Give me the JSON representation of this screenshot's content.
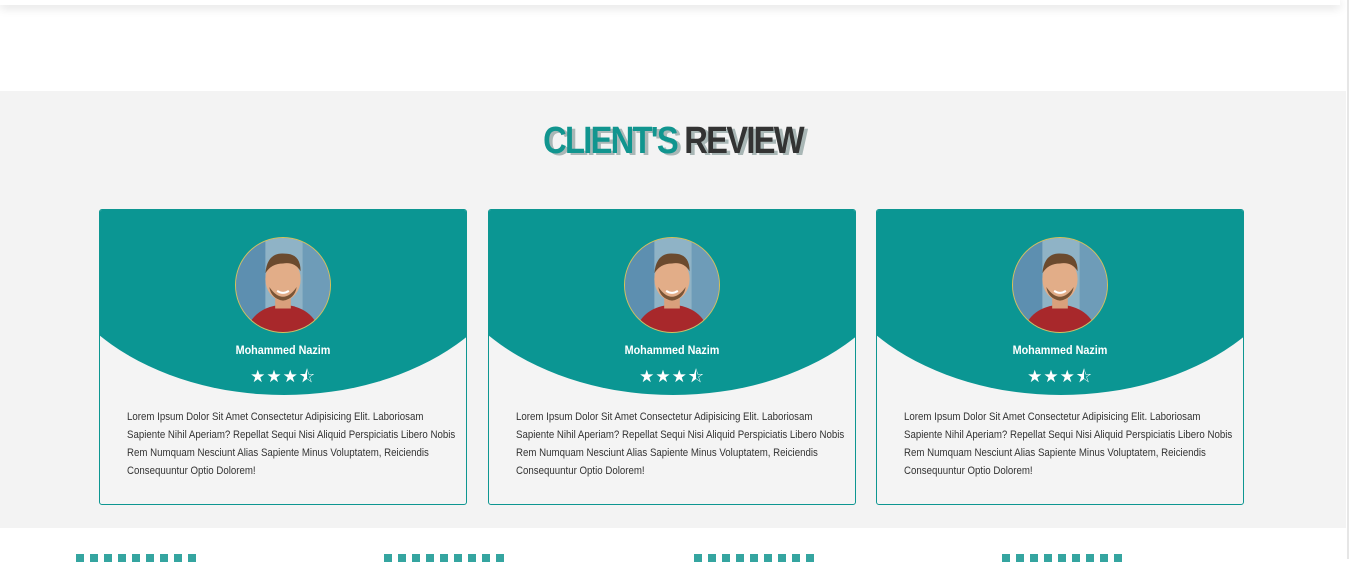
{
  "section": {
    "title_accent": "CLIENT'S",
    "title_rest": "REVIEW"
  },
  "reviews": [
    {
      "name": "Mohammed Nazim",
      "rating": 3.5,
      "stars": "★★★⯪",
      "avatar_icon": "user-photo",
      "text": "Lorem Ipsum Dolor Sit Amet Consectetur Adipisicing Elit. Laboriosam Sapiente Nihil Aperiam? Repellat Sequi Nisi Aliquid Perspiciatis Libero Nobis Rem Numquam Nesciunt Alias Sapiente Minus Voluptatem, Reiciendis Consequuntur Optio Dolorem!"
    },
    {
      "name": "Mohammed Nazim",
      "rating": 3.5,
      "stars": "★★★⯪",
      "avatar_icon": "user-photo",
      "text": "Lorem Ipsum Dolor Sit Amet Consectetur Adipisicing Elit. Laboriosam Sapiente Nihil Aperiam? Repellat Sequi Nisi Aliquid Perspiciatis Libero Nobis Rem Numquam Nesciunt Alias Sapiente Minus Voluptatem, Reiciendis Consequuntur Optio Dolorem!"
    },
    {
      "name": "Mohammed Nazim",
      "rating": 3.5,
      "stars": "★★★⯪",
      "avatar_icon": "user-photo",
      "text": "Lorem Ipsum Dolor Sit Amet Consectetur Adipisicing Elit. Laboriosam Sapiente Nihil Aperiam? Repellat Sequi Nisi Aliquid Perspiciatis Libero Nobis Rem Numquam Nesciunt Alias Sapiente Minus Voluptatem, Reiciendis Consequuntur Optio Dolorem!"
    }
  ],
  "colors": {
    "accent": "#0b9693",
    "title_dark": "#333333",
    "section_bg": "#f3f3f3"
  }
}
